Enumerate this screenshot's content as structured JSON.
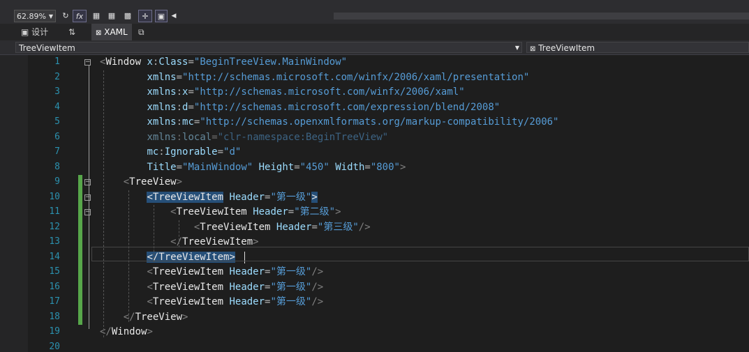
{
  "toolbar": {
    "zoom": "62.89%",
    "fx_label": "fx"
  },
  "tabs": {
    "design": "设计",
    "swap": "⇅",
    "xaml": "XAML"
  },
  "nav": {
    "left": "TreeViewItem",
    "right": "TreeViewItem"
  },
  "editor": {
    "line_numbers": [
      "1",
      "2",
      "3",
      "4",
      "5",
      "6",
      "7",
      "8",
      "9",
      "10",
      "11",
      "12",
      "13",
      "14",
      "15",
      "16",
      "17",
      "18",
      "19",
      "20"
    ],
    "lines": [
      {
        "indent": "",
        "tokens": [
          [
            "tag",
            "<"
          ],
          [
            "el",
            "Window"
          ],
          [
            "q",
            " "
          ],
          [
            "at",
            "x"
          ],
          [
            "eq",
            ":"
          ],
          [
            "at",
            "Class"
          ],
          [
            "eq",
            "="
          ],
          [
            "str",
            "\"BeginTreeView.MainWindow\""
          ]
        ]
      },
      {
        "indent": "        ",
        "tokens": [
          [
            "at",
            "xmlns"
          ],
          [
            "eq",
            "="
          ],
          [
            "str",
            "\"http://schemas.microsoft.com/winfx/2006/xaml/presentation\""
          ]
        ]
      },
      {
        "indent": "        ",
        "tokens": [
          [
            "at",
            "xmlns"
          ],
          [
            "eq",
            ":"
          ],
          [
            "at",
            "x"
          ],
          [
            "eq",
            "="
          ],
          [
            "str",
            "\"http://schemas.microsoft.com/winfx/2006/xaml\""
          ]
        ]
      },
      {
        "indent": "        ",
        "tokens": [
          [
            "at",
            "xmlns"
          ],
          [
            "eq",
            ":"
          ],
          [
            "at",
            "d"
          ],
          [
            "eq",
            "="
          ],
          [
            "str",
            "\"http://schemas.microsoft.com/expression/blend/2008\""
          ]
        ]
      },
      {
        "indent": "        ",
        "tokens": [
          [
            "at",
            "xmlns"
          ],
          [
            "eq",
            ":"
          ],
          [
            "at",
            "mc"
          ],
          [
            "eq",
            "="
          ],
          [
            "str",
            "\"http://schemas.openxmlformats.org/markup-compatibility/2006\""
          ]
        ]
      },
      {
        "indent": "        ",
        "dim": true,
        "tokens": [
          [
            "at",
            "xmlns"
          ],
          [
            "eq",
            ":"
          ],
          [
            "at",
            "local"
          ],
          [
            "eq",
            "="
          ],
          [
            "str",
            "\"clr-namespace:BeginTreeView\""
          ]
        ]
      },
      {
        "indent": "        ",
        "tokens": [
          [
            "at",
            "mc"
          ],
          [
            "eq",
            ":"
          ],
          [
            "at",
            "Ignorable"
          ],
          [
            "eq",
            "="
          ],
          [
            "str",
            "\"d\""
          ]
        ]
      },
      {
        "indent": "        ",
        "tokens": [
          [
            "at",
            "Title"
          ],
          [
            "eq",
            "="
          ],
          [
            "str",
            "\"MainWindow\""
          ],
          [
            "q",
            " "
          ],
          [
            "at",
            "Height"
          ],
          [
            "eq",
            "="
          ],
          [
            "str",
            "\"450\""
          ],
          [
            "q",
            " "
          ],
          [
            "at",
            "Width"
          ],
          [
            "eq",
            "="
          ],
          [
            "str",
            "\"800\""
          ],
          [
            "tag",
            ">"
          ]
        ]
      },
      {
        "indent": "    ",
        "tokens": [
          [
            "tag",
            "<"
          ],
          [
            "el",
            "TreeView"
          ],
          [
            "tag",
            ">"
          ]
        ]
      },
      {
        "indent": "        ",
        "tokens": [
          [
            "hl",
            "<TreeViewItem"
          ],
          [
            "q",
            " "
          ],
          [
            "at",
            "Header"
          ],
          [
            "eq",
            "="
          ],
          [
            "str",
            "\"第一级\""
          ],
          [
            "hl",
            ">"
          ]
        ]
      },
      {
        "indent": "            ",
        "tokens": [
          [
            "tag",
            "<"
          ],
          [
            "el",
            "TreeViewItem"
          ],
          [
            "q",
            " "
          ],
          [
            "at",
            "Header"
          ],
          [
            "eq",
            "="
          ],
          [
            "str",
            "\"第二级\""
          ],
          [
            "tag",
            ">"
          ]
        ]
      },
      {
        "indent": "                ",
        "tokens": [
          [
            "tag",
            "<"
          ],
          [
            "el",
            "TreeViewItem"
          ],
          [
            "q",
            " "
          ],
          [
            "at",
            "Header"
          ],
          [
            "eq",
            "="
          ],
          [
            "str",
            "\"第三级\""
          ],
          [
            "tag",
            "/>"
          ]
        ]
      },
      {
        "indent": "            ",
        "tokens": [
          [
            "tag",
            "</"
          ],
          [
            "el",
            "TreeViewItem"
          ],
          [
            "tag",
            ">"
          ]
        ]
      },
      {
        "indent": "        ",
        "tokens": [
          [
            "hl",
            "</TreeViewItem"
          ],
          [
            "hl",
            ">"
          ]
        ]
      },
      {
        "indent": "        ",
        "tokens": [
          [
            "tag",
            "<"
          ],
          [
            "el",
            "TreeViewItem"
          ],
          [
            "q",
            " "
          ],
          [
            "at",
            "Header"
          ],
          [
            "eq",
            "="
          ],
          [
            "str",
            "\"第一级\""
          ],
          [
            "tag",
            "/>"
          ]
        ]
      },
      {
        "indent": "        ",
        "tokens": [
          [
            "tag",
            "<"
          ],
          [
            "el",
            "TreeViewItem"
          ],
          [
            "q",
            " "
          ],
          [
            "at",
            "Header"
          ],
          [
            "eq",
            "="
          ],
          [
            "str",
            "\"第一级\""
          ],
          [
            "tag",
            "/>"
          ]
        ]
      },
      {
        "indent": "        ",
        "tokens": [
          [
            "tag",
            "<"
          ],
          [
            "el",
            "TreeViewItem"
          ],
          [
            "q",
            " "
          ],
          [
            "at",
            "Header"
          ],
          [
            "eq",
            "="
          ],
          [
            "str",
            "\"第一级\""
          ],
          [
            "tag",
            "/>"
          ]
        ]
      },
      {
        "indent": "    ",
        "tokens": [
          [
            "tag",
            "</"
          ],
          [
            "el",
            "TreeView"
          ],
          [
            "tag",
            ">"
          ]
        ]
      },
      {
        "indent": "",
        "tokens": [
          [
            "tag",
            "</"
          ],
          [
            "el",
            "Window"
          ],
          [
            "tag",
            ">"
          ]
        ]
      },
      {
        "indent": "",
        "tokens": []
      }
    ]
  },
  "colors": {
    "background": "#1e1e1e",
    "line_number": "#2b91af",
    "string": "#569cd6",
    "attribute": "#9cdcfe",
    "change_bar": "#57a64a",
    "selection": "#264f78"
  }
}
